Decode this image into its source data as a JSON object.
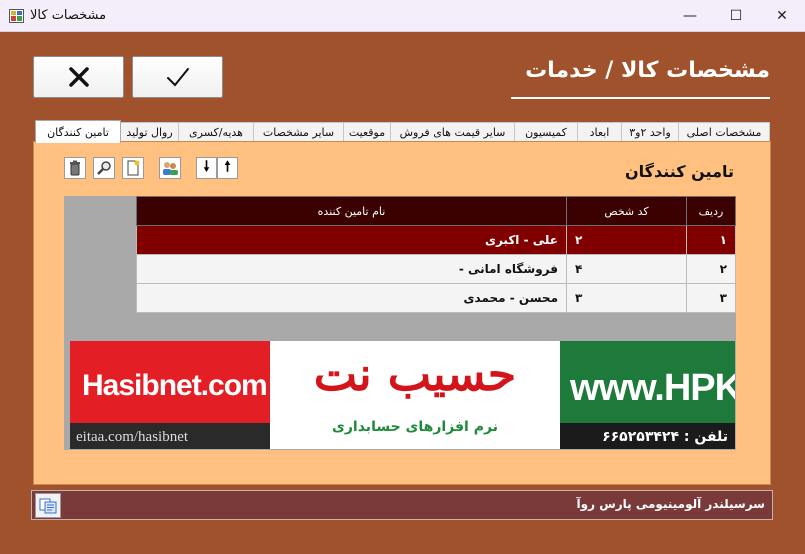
{
  "window": {
    "title": "مشخصات کالا",
    "minimize": "—",
    "maximize": "☐",
    "close": "✕"
  },
  "buttons": {
    "cancel_glyph": "✕",
    "ok_glyph": "✓"
  },
  "heading": "مشخصات کالا / خدمات",
  "tabs": [
    {
      "label": "مشخصات اصلی",
      "active": false
    },
    {
      "label": "واحد ۲و۳",
      "active": false
    },
    {
      "label": "ابعاد",
      "active": false
    },
    {
      "label": "کمیسیون",
      "active": false
    },
    {
      "label": "سایر قیمت های فروش",
      "active": false
    },
    {
      "label": "موقعیت",
      "active": false
    },
    {
      "label": "سایر مشخصات",
      "active": false
    },
    {
      "label": "هدیه/کسری",
      "active": false
    },
    {
      "label": "روال تولید",
      "active": false
    },
    {
      "label": "تامین کنندگان",
      "active": true
    }
  ],
  "section": {
    "title": "تامین کنندگان"
  },
  "toolbar": {
    "icons": [
      "delete-icon",
      "search-icon",
      "new-icon",
      "users-icon",
      "arrow-down-icon",
      "arrow-up-icon"
    ],
    "down_glyph": "🠗",
    "up_glyph": "🠕"
  },
  "grid": {
    "columns": [
      "ردیف",
      "کد شخص",
      "نام تامین کننده"
    ],
    "rows": [
      {
        "row": "۱",
        "code": "۲",
        "name": "علی - اکبری",
        "selected": true
      },
      {
        "row": "۲",
        "code": "۴",
        "name": "فروشگاه امانی -",
        "selected": false
      },
      {
        "row": "۳",
        "code": "۳",
        "name": "محسن - محمدی",
        "selected": false
      }
    ]
  },
  "banner": {
    "site": "Hasibnet.com",
    "eitaa": "eitaa.com/hasibnet",
    "brand": "حسیب نت",
    "tagline": "نرم افزارهای حسابداری",
    "hpk": "www.HPK.IR",
    "phone": "تلفن : ۶۶۵۲۵۳۴۲۴"
  },
  "footer": {
    "description": "سرسیلندر آلومینیومی پارس روآ"
  },
  "colors": {
    "background": "#a0522d",
    "panel": "#ffc080",
    "header": "#3b0000",
    "selected_row": "#800000",
    "footer": "#7a3a3a"
  }
}
